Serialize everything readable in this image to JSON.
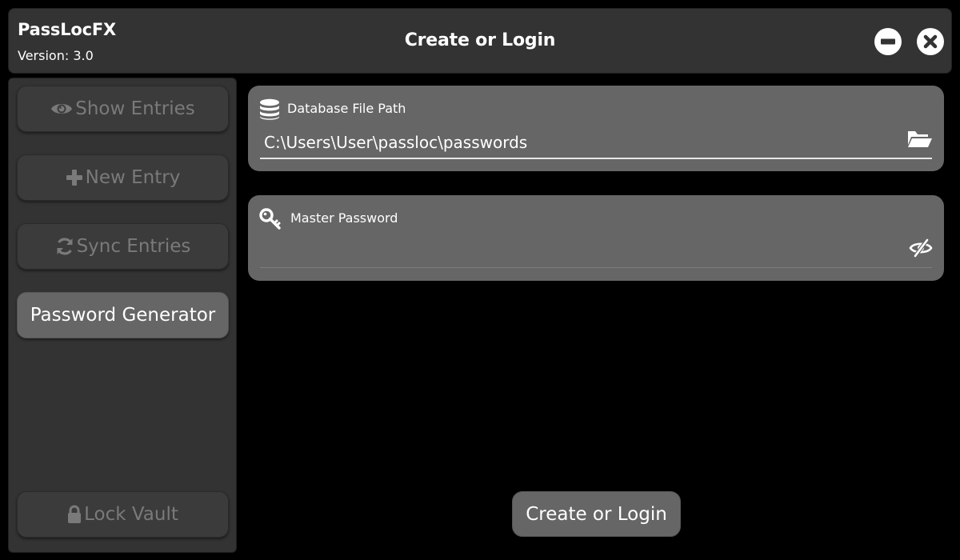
{
  "app": {
    "name": "PassLocFX",
    "version": "Version: 3.0",
    "window_title": "Create or Login"
  },
  "window_controls": {
    "minimize_icon": "minus-circle-icon",
    "close_icon": "x-circle-icon"
  },
  "sidebar": {
    "items": [
      {
        "label": "Show Entries",
        "icon": "eye-icon",
        "active": false
      },
      {
        "label": "New Entry",
        "icon": "plus-icon",
        "active": false
      },
      {
        "label": "Sync Entries",
        "icon": "sync-icon",
        "active": false
      },
      {
        "label": "Password Generator",
        "icon": "",
        "active": true
      },
      {
        "label": "Lock Vault",
        "icon": "lock-icon",
        "active": false
      }
    ]
  },
  "database": {
    "label": "Database File Path",
    "icon": "database-icon",
    "value": "C:\\Users\\User\\passloc\\passwords",
    "action_icon": "folder-open-icon"
  },
  "master_password": {
    "label": "Master Password",
    "icon": "key-icon",
    "value": "",
    "action_icon": "eye-slash-icon"
  },
  "submit": {
    "label": "Create or Login"
  },
  "colors": {
    "background": "#000000",
    "panel": "#333333",
    "card": "#666666",
    "text": "#ffffff",
    "muted_text": "#7a7a7a"
  }
}
